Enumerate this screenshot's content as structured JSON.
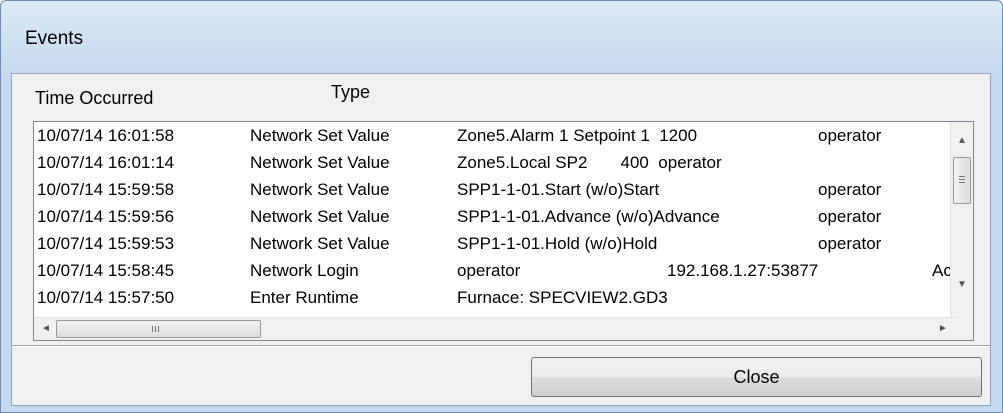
{
  "window": {
    "title": "Events"
  },
  "columns": {
    "time": "Time Occurred",
    "type": "Type"
  },
  "events": [
    {
      "time": "10/07/14 16:01:58",
      "type": "Network Set Value",
      "desc": "Zone5.Alarm 1 Setpoint 1  1200",
      "user": "operator"
    },
    {
      "time": "10/07/14 16:01:14",
      "type": "Network Set Value",
      "desc": "Zone5.Local SP2       400  operator"
    },
    {
      "time": "10/07/14 15:59:58",
      "type": "Network Set Value",
      "desc": "SPP1-1-01.Start (w/o)Start",
      "user": "operator"
    },
    {
      "time": "10/07/14 15:59:56",
      "type": "Network Set Value",
      "desc": "SPP1-1-01.Advance (w/o)Advance",
      "user": "operator"
    },
    {
      "time": "10/07/14 15:59:53",
      "type": "Network Set Value",
      "desc": "SPP1-1-01.Hold (w/o)Hold",
      "user": "operator"
    },
    {
      "time": "10/07/14 15:58:45",
      "type": "Network Login",
      "desc": "operator",
      "ip": "192.168.1.27:53877",
      "status": "Acce"
    },
    {
      "time": "10/07/14 15:57:50",
      "type": "Enter Runtime",
      "desc": "Furnace: SPECVIEW2.GD3"
    }
  ],
  "scrollbars": {
    "up_icon": "▲",
    "down_icon": "▼",
    "left_icon": "◄",
    "right_icon": "►"
  },
  "buttons": {
    "close": "Close"
  }
}
